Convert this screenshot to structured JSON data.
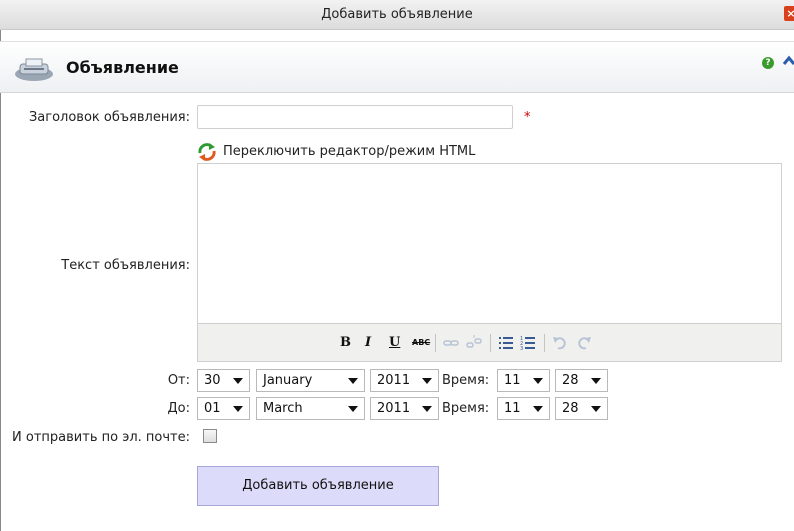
{
  "window": {
    "title": "Добавить объявление",
    "close_icon": "close-icon"
  },
  "section": {
    "title": "Объявление",
    "icon": "fax-icon"
  },
  "form": {
    "title_label": "Заголовок объявления:",
    "title_value": "",
    "required_mark": "*",
    "toggle_editor": "Переключить редактор/режим HTML",
    "text_label": "Текст объявления:",
    "text_value": "",
    "toolbar": {
      "bold": "B",
      "italic": "I",
      "underline": "U",
      "strike": "ABC"
    },
    "from": {
      "label": "От:",
      "day": "30",
      "month": "January",
      "year": "2011",
      "time_label": "Время:",
      "hour": "11",
      "minute": "28"
    },
    "to": {
      "label": "До:",
      "day": "01",
      "month": "March",
      "year": "2011",
      "time_label": "Время:",
      "hour": "11",
      "minute": "28"
    },
    "email_label": "И отправить по эл. почте:",
    "email_checked": false,
    "submit_label": "Добавить объявление"
  },
  "colors": {
    "submit_bg": "#dcdcfa",
    "required": "#d40000",
    "help": "#3a9a2e",
    "close": "#d8411c"
  }
}
